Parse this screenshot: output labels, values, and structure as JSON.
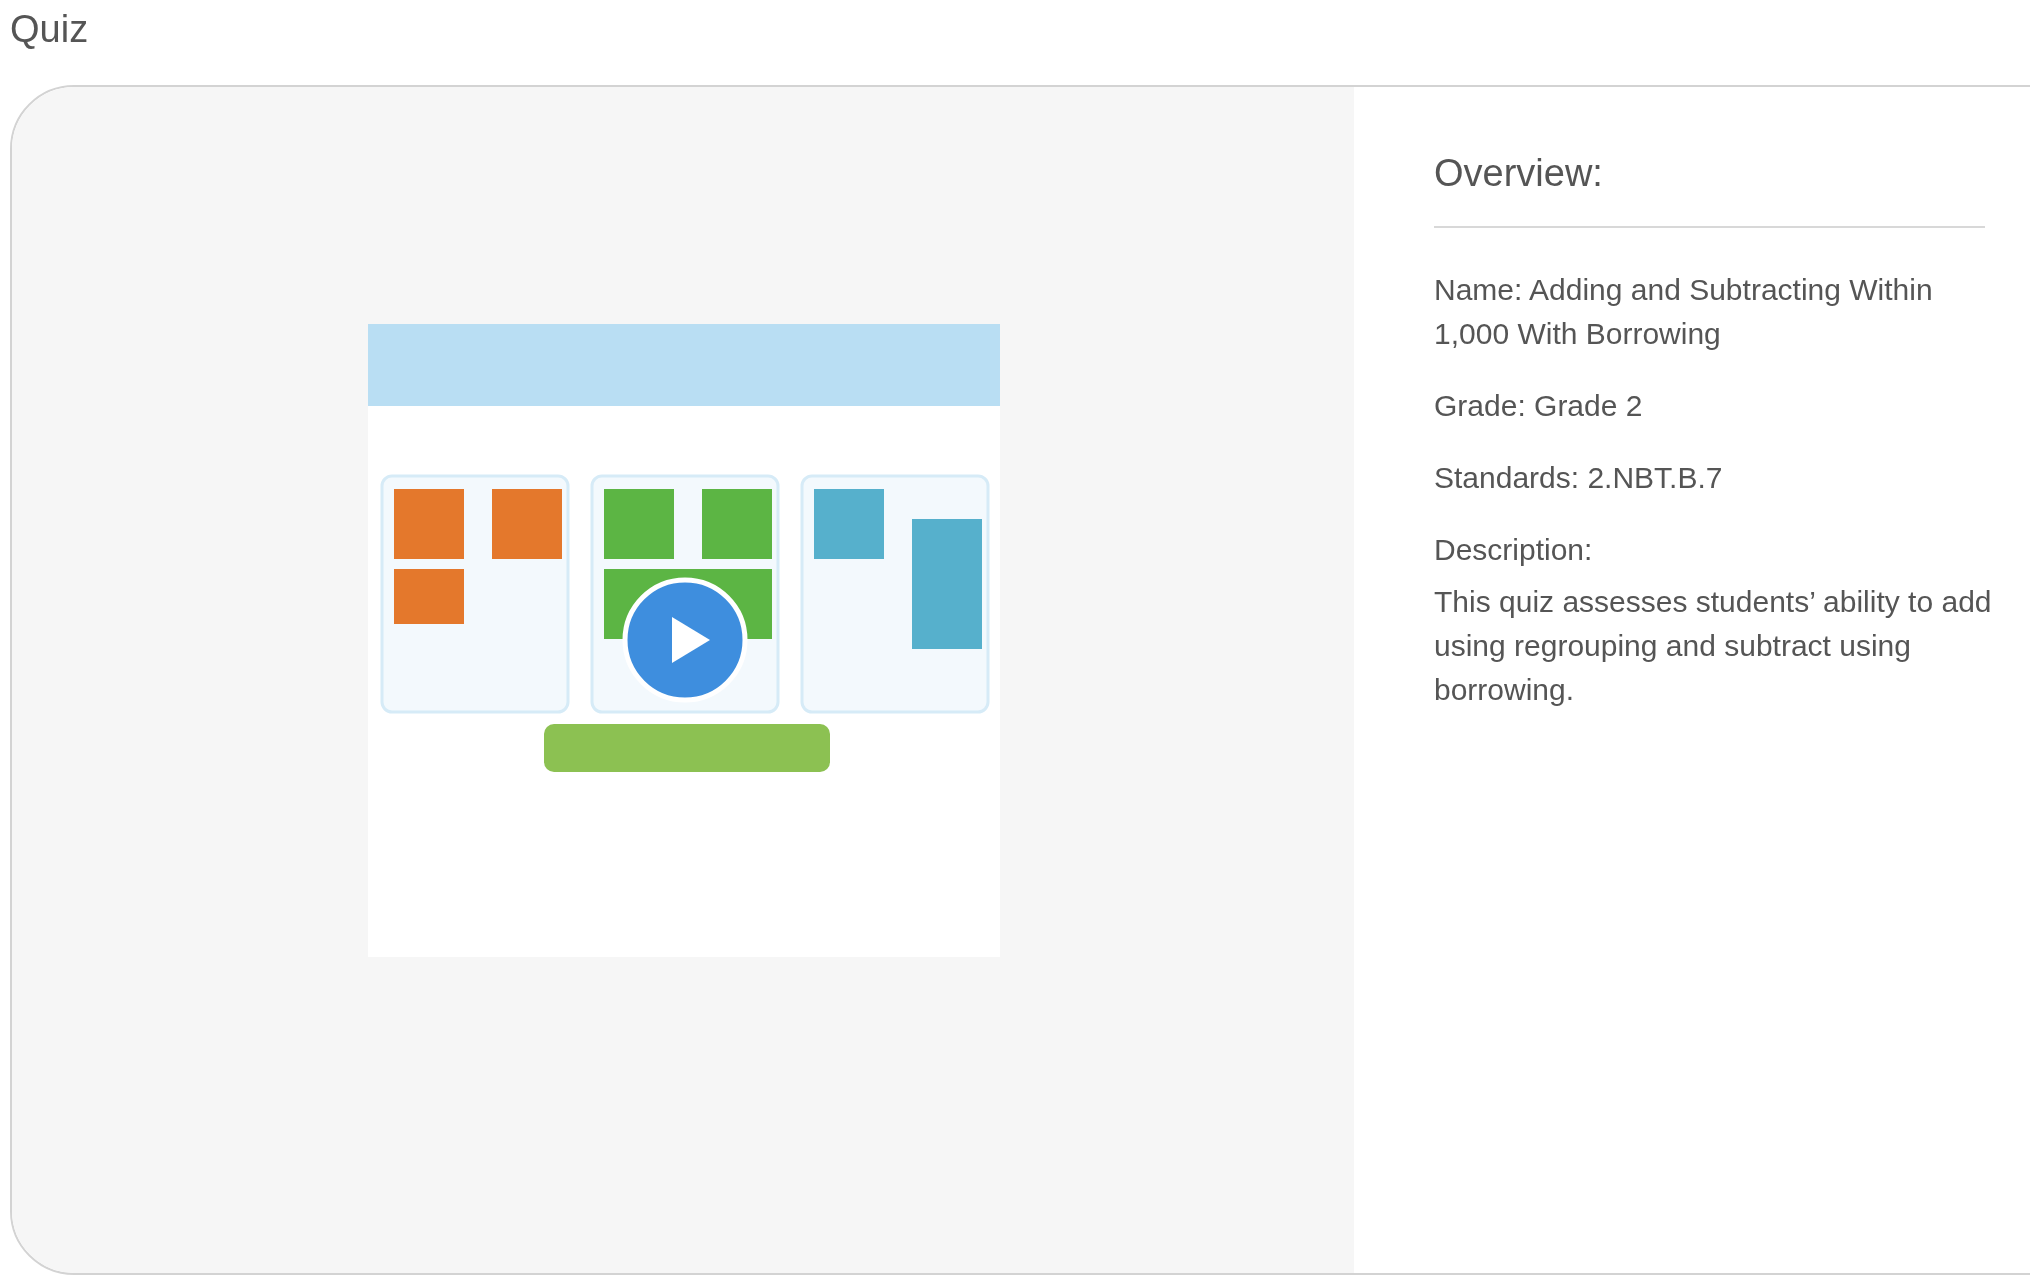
{
  "page": {
    "title": "Quiz"
  },
  "overview": {
    "heading": "Overview:",
    "fields": [
      {
        "label": "Name:",
        "value": "Adding and Subtracting Within 1,000 With Borrowing"
      },
      {
        "label": "Grade:",
        "value": "Grade 2"
      },
      {
        "label": "Standards:",
        "value": "2.NBT.B.7"
      }
    ],
    "description": {
      "label": "Description:",
      "text": "This quiz assesses students’ ability to add using regrouping and subtract using borrowing."
    }
  }
}
